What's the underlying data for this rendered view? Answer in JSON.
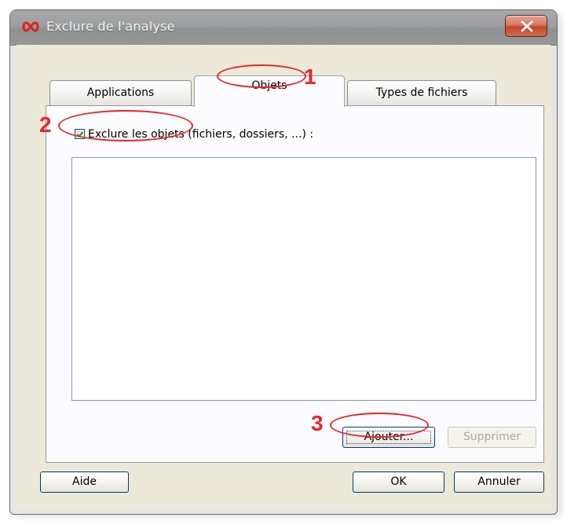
{
  "window": {
    "title": "Exclure de l'analyse",
    "app_icon": "infinity-icon",
    "close_icon": "close-icon"
  },
  "tabs": [
    {
      "label": "Applications",
      "selected": false
    },
    {
      "label": "Objets",
      "selected": true
    },
    {
      "label": "Types de fichiers",
      "selected": false
    }
  ],
  "objets_panel": {
    "exclude_checkbox_checked": true,
    "exclude_label": "Exclure les objets (fichiers, dossiers, ...) :",
    "list_items": [],
    "add_button": "Ajouter...",
    "remove_button": "Supprimer",
    "remove_button_enabled": false
  },
  "footer": {
    "help_button": "Aide",
    "ok_button": "OK",
    "cancel_button": "Annuler"
  },
  "annotations": [
    "1",
    "2",
    "3"
  ],
  "colors": {
    "annotation_red": "#e8252b",
    "title_bar": "#9c9e9f",
    "close_button": "#c2472c",
    "panel_background": "#fcfcfe",
    "checkbox_check": "#21a121"
  }
}
